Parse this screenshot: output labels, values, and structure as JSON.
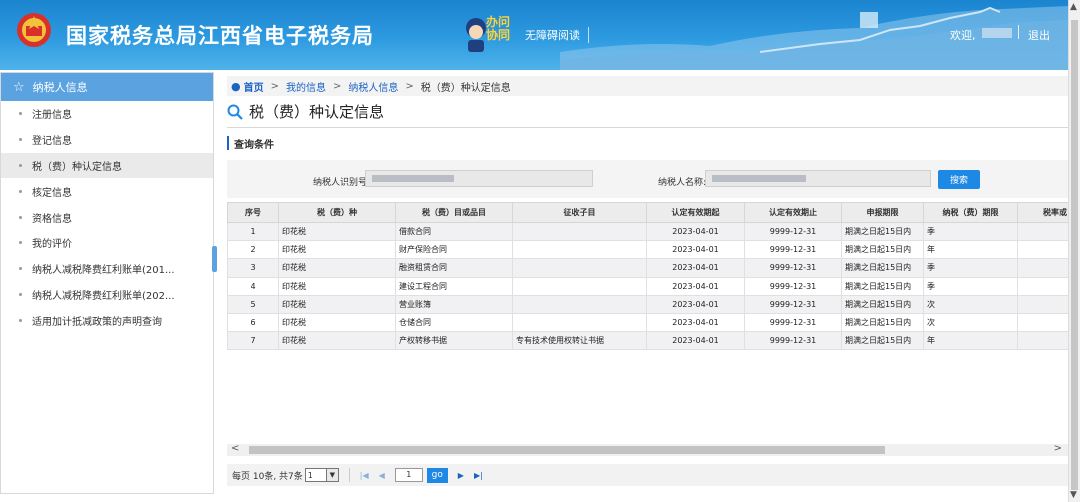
{
  "header": {
    "site_title": "国家税务总局江西省电子税务局",
    "emblem_caption": "中国税务",
    "mascot_text_1": "办问",
    "mascot_text_2": "协同",
    "accessibility": "无障碍阅读",
    "welcome": "欢迎,",
    "logout": "退出"
  },
  "sidebar": {
    "title": "纳税人信息",
    "items": [
      {
        "label": "注册信息"
      },
      {
        "label": "登记信息"
      },
      {
        "label": "税（费）种认定信息"
      },
      {
        "label": "核定信息"
      },
      {
        "label": "资格信息"
      },
      {
        "label": "我的评价"
      },
      {
        "label": "纳税人减税降费红利账单(201..."
      },
      {
        "label": "纳税人减税降费红利账单(202..."
      },
      {
        "label": "适用加计抵减政策的声明查询"
      }
    ]
  },
  "breadcrumb": {
    "home": "首页",
    "arrow": ">",
    "level1": "我的信息",
    "level2": "纳税人信息",
    "current": "税（费）种认定信息"
  },
  "page_title": "税（费）种认定信息",
  "query": {
    "section_label": "查询条件",
    "taxpayer_id_label": "纳税人识别号:",
    "taxpayer_name_label": "纳税人名称:",
    "search_label": "搜索"
  },
  "table": {
    "headers": [
      "序号",
      "税（费）种",
      "税（费）目或品目",
      "征收子目",
      "认定有效期起",
      "认定有效期止",
      "申报期限",
      "纳税（费）期限",
      "税率或"
    ],
    "rows": [
      [
        "1",
        "印花税",
        "借款合同",
        "",
        "2023-04-01",
        "9999-12-31",
        "期满之日起15日内",
        "季"
      ],
      [
        "2",
        "印花税",
        "财产保险合同",
        "",
        "2023-04-01",
        "9999-12-31",
        "期满之日起15日内",
        "年"
      ],
      [
        "3",
        "印花税",
        "融资租赁合同",
        "",
        "2023-04-01",
        "9999-12-31",
        "期满之日起15日内",
        "季"
      ],
      [
        "4",
        "印花税",
        "建设工程合同",
        "",
        "2023-04-01",
        "9999-12-31",
        "期满之日起15日内",
        "季"
      ],
      [
        "5",
        "印花税",
        "营业账簿",
        "",
        "2023-04-01",
        "9999-12-31",
        "期满之日起15日内",
        "次"
      ],
      [
        "6",
        "印花税",
        "仓储合同",
        "",
        "2023-04-01",
        "9999-12-31",
        "期满之日起15日内",
        "次"
      ],
      [
        "7",
        "印花税",
        "产权转移书据",
        "专有技术使用权转让书据",
        "2023-04-01",
        "9999-12-31",
        "期满之日起15日内",
        "年"
      ]
    ]
  },
  "pager": {
    "summary": "每页 10条, 共7条",
    "page_size": "1",
    "current_page": "1",
    "go_label": "go"
  },
  "colors": {
    "header": "#2d9ae0",
    "sidebar_active": "#5aa2e0",
    "link": "#1a62c4",
    "button": "#1e88e5"
  }
}
